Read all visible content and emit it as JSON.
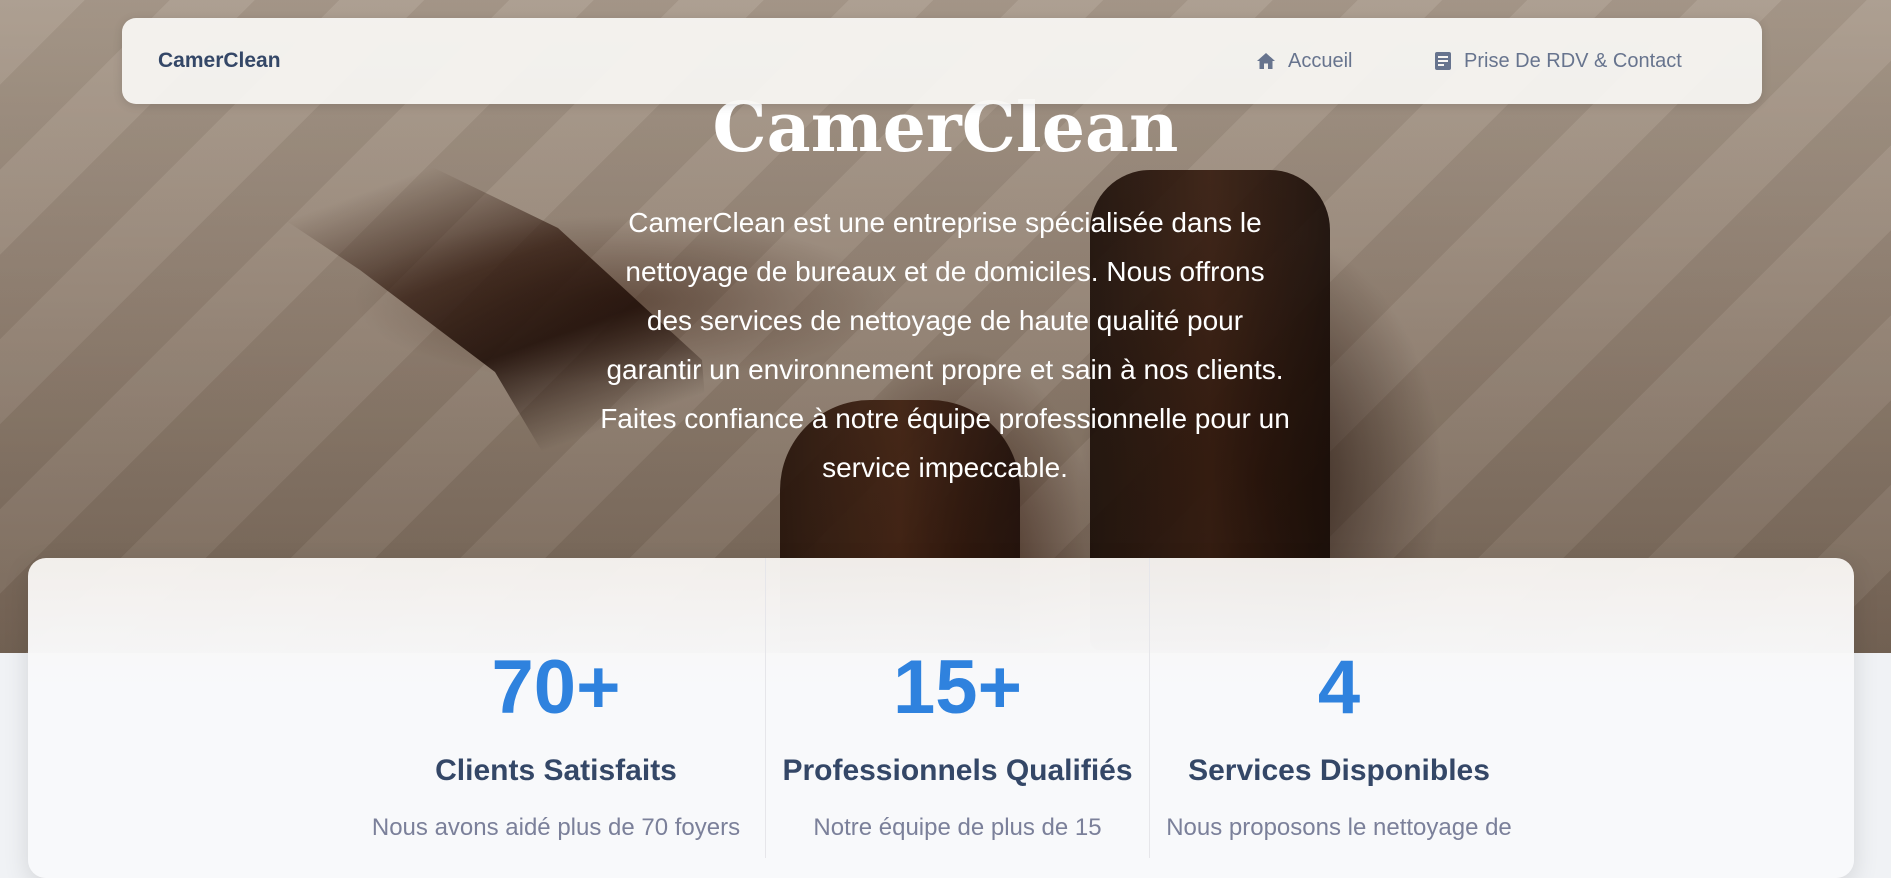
{
  "navbar": {
    "brand": "CamerClean",
    "items": [
      {
        "label": "Accueil",
        "icon": "home-icon"
      },
      {
        "label": "Prise De RDV & Contact",
        "icon": "document-icon"
      }
    ]
  },
  "hero": {
    "title": "CamerClean",
    "description": "CamerClean est une entreprise spécialisée dans le nettoyage de bureaux et de domiciles. Nous offrons des services de nettoyage de haute qualité pour garantir un environnement propre et sain à nos clients. Faites confiance à notre équipe professionnelle pour un service impeccable."
  },
  "stats": [
    {
      "number": "70+",
      "title": "Clients Satisfaits",
      "description": "Nous avons aidé plus de 70 foyers"
    },
    {
      "number": "15+",
      "title": "Professionnels Qualifiés",
      "description": "Notre équipe de plus de 15"
    },
    {
      "number": "4",
      "title": "Services Disponibles",
      "description": "Nous proposons le nettoyage de"
    }
  ],
  "colors": {
    "accent": "#2f82de",
    "heading": "#344767",
    "muted": "#7b809a"
  }
}
